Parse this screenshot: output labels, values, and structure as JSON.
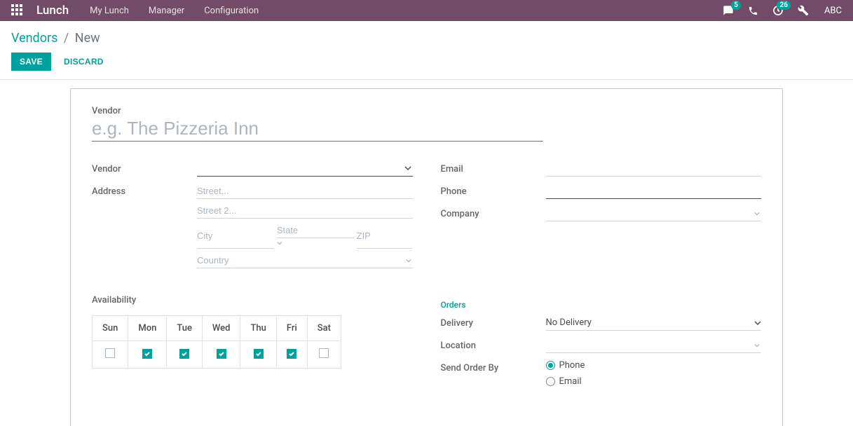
{
  "topbar": {
    "brand": "Lunch",
    "nav": [
      "My Lunch",
      "Manager",
      "Configuration"
    ],
    "msg_badge": "5",
    "activity_badge": "26",
    "user": "ABC"
  },
  "breadcrumb": {
    "parent": "Vendors",
    "current": "New"
  },
  "actions": {
    "save": "SAVE",
    "discard": "DISCARD"
  },
  "form": {
    "vendor_name_label": "Vendor",
    "vendor_name_placeholder": "e.g. The Pizzeria Inn",
    "vendor_label": "Vendor",
    "address_label": "Address",
    "street_ph": "Street...",
    "street2_ph": "Street 2...",
    "city_ph": "City",
    "state_ph": "State",
    "zip_ph": "ZIP",
    "country_ph": "Country",
    "email_label": "Email",
    "phone_label": "Phone",
    "company_label": "Company",
    "availability_label": "Availability",
    "days": [
      "Sun",
      "Mon",
      "Tue",
      "Wed",
      "Thu",
      "Fri",
      "Sat"
    ],
    "days_checked": [
      false,
      true,
      true,
      true,
      true,
      true,
      false
    ],
    "orders_title": "Orders",
    "delivery_label": "Delivery",
    "delivery_value": "No Delivery",
    "location_label": "Location",
    "send_order_label": "Send Order By",
    "send_order_options": [
      "Phone",
      "Email"
    ],
    "send_order_selected": "Phone"
  },
  "icons": {
    "chat": "chat-icon",
    "phone": "phone-icon",
    "clock": "clock-icon",
    "wrench": "wrench-icon"
  }
}
